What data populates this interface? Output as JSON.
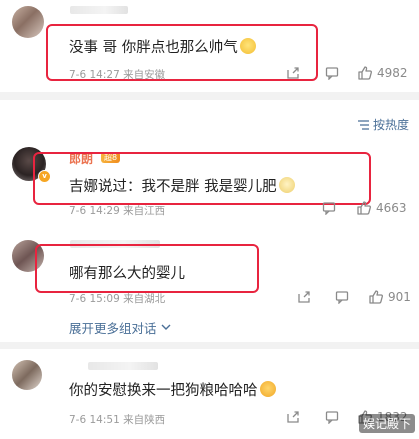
{
  "comments": [
    {
      "text": "没事 哥 你胖点也那么帅气",
      "meta": "7-6 14:27  来自安徽",
      "likes": "4982"
    },
    {
      "username": "郎朗",
      "badge": "超8",
      "text": "吉娜说过：我不是胖 我是婴儿肥",
      "meta": "7-6 14:29  来自江西",
      "likes": "4663"
    },
    {
      "text": "哪有那么大的婴儿",
      "meta": "7-6 15:09  来自湖北",
      "likes": "901"
    },
    {
      "text": "你的安慰换来一把狗粮哈哈哈",
      "meta": "7-6 14:51  来自陕西",
      "likes": "1832"
    }
  ],
  "sort_label": "按热度",
  "expand_label": "展开更多组对话",
  "watermark": "娱记殿下",
  "colors": {
    "highlight_box": "#e8243f",
    "link_blue": "#4a6f97",
    "username_orange": "#eb7350"
  }
}
